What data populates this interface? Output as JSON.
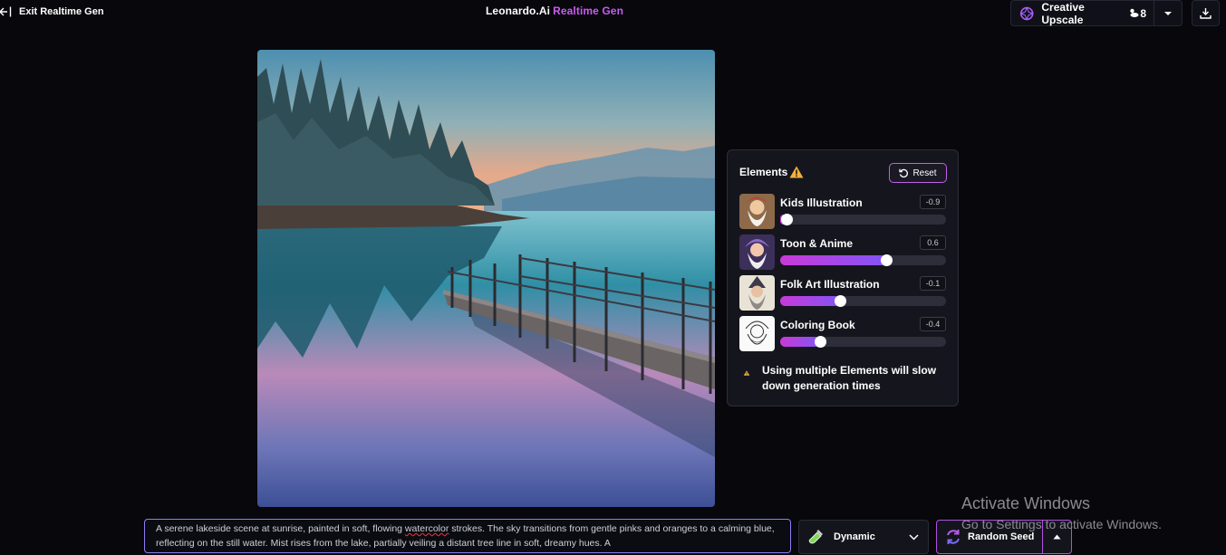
{
  "header": {
    "exit_label": "Exit Realtime Gen",
    "brand_name": "Leonardo.Ai",
    "brand_mode": "Realtime Gen",
    "upscale_label": "Creative Upscale",
    "upscale_cost": "8"
  },
  "elements_panel": {
    "title": "Elements",
    "reset_label": "Reset",
    "items": [
      {
        "name": "Kids Illustration",
        "value": "-0.9",
        "slider_fraction": 0.04
      },
      {
        "name": "Toon & Anime",
        "value": "0.6",
        "slider_fraction": 0.64
      },
      {
        "name": "Folk Art Illustration",
        "value": "-0.1",
        "slider_fraction": 0.36
      },
      {
        "name": "Coloring Book",
        "value": "-0.4",
        "slider_fraction": 0.24
      }
    ],
    "warning": "Using multiple Elements will slow down generation times"
  },
  "prompt": {
    "text_before": "A serene lakeside scene at sunrise, painted in soft, flowing ",
    "misspelled_word": "watercolor",
    "text_after": " strokes. The sky transitions from gentle pinks and oranges to a calming blue, reflecting on the still water. Mist rises from the lake, partially veiling a distant tree line in soft, dreamy hues. A"
  },
  "style_select": {
    "value": "Dynamic"
  },
  "seed": {
    "label": "Random Seed"
  },
  "watermark": {
    "line1": "Activate Windows",
    "line2": "Go to Settings to activate Windows."
  },
  "colors": {
    "background": "#07070c",
    "accent_purple": "#c85cf2",
    "panel": "#15161d",
    "warning": "#f5b03c"
  }
}
